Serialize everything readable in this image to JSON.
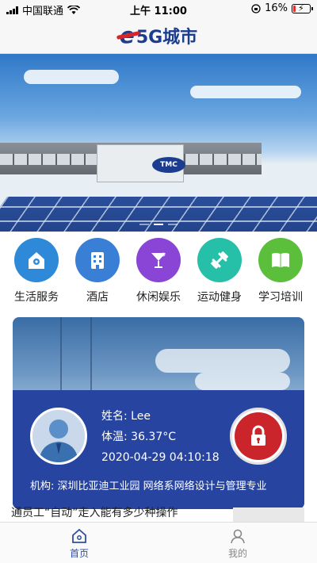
{
  "status_bar": {
    "carrier": "中国联通",
    "time": "上午 11:00",
    "battery": "16%",
    "battery_level": 0.16
  },
  "header": {
    "logo_text": "5G城市"
  },
  "banner": {
    "building_sign": "TMC",
    "slide_count": 3,
    "active_slide": 1
  },
  "categories": [
    {
      "label": "生活服务",
      "icon": "home-location-icon",
      "color": "#2e8ad8"
    },
    {
      "label": "酒店",
      "icon": "building-icon",
      "color": "#3a7fd6"
    },
    {
      "label": "休闲娱乐",
      "icon": "cocktail-icon",
      "color": "#8a45d6"
    },
    {
      "label": "运动健身",
      "icon": "dumbbell-icon",
      "color": "#26bfa8"
    },
    {
      "label": "学习培训",
      "icon": "book-icon",
      "color": "#5cbf3c"
    }
  ],
  "profile_card": {
    "name": "姓名: Lee",
    "temperature": "体温: 36.37°C",
    "datetime": "2020-04-29 04:10:18",
    "organization": "机构: 深圳比亚迪工业园  网络系网络设计与管理专业",
    "lock_icon": "lock-icon",
    "avatar_icon": "user-avatar-icon"
  },
  "news": {
    "headline": "通员工“自动”走入能有多少种操作"
  },
  "tabbar": {
    "home_label": "首页",
    "mine_label": "我的",
    "active_color": "#2e4fa3",
    "inactive_color": "#888888"
  }
}
